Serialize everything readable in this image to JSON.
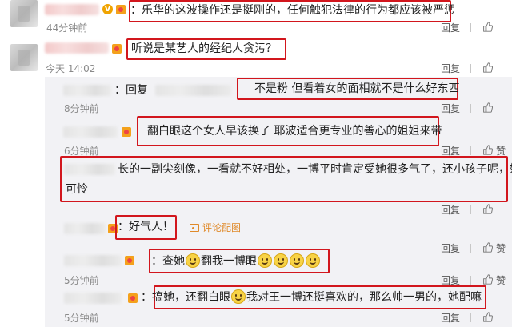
{
  "comments": [
    {
      "text": "：乐华的这波操作还是挺刚的，任何触犯法律的行为都应该被严惩",
      "time": "44分钟前",
      "reply": "回复"
    },
    {
      "text": "听说是某艺人的经纪人贪污？",
      "time": "今天 14:02",
      "reply": "回复"
    }
  ],
  "replies": [
    {
      "prefix": "：回复",
      "text": "不是粉 但看着女的面相就不是什么好东西",
      "time": "8分钟前",
      "reply": "回复"
    },
    {
      "text": "翻白眼这个女人早该换了 耶波适合更专业的善心的姐姐来带",
      "time": "6分钟前",
      "reply": "回复",
      "like": "赞"
    },
    {
      "line1": "长的一副尖刻像，一看就不好相处，一博平时肯定受她很多气了，还小孩子呢，好",
      "line2": "可怜",
      "reply": "回复"
    },
    {
      "text": "：好气人！",
      "image_link": "评论配图",
      "reply": "回复",
      "like": "赞"
    },
    {
      "text_a": "：查她",
      "text_b": "翻我一博眼",
      "time": "5分钟前",
      "reply": "回复",
      "like": "赞"
    },
    {
      "text_a": "：搞她，还翻白眼",
      "text_b": "我对王一博还挺喜欢的，那么帅一男的，她配嘛",
      "time": "5分钟前",
      "reply": "回复"
    }
  ],
  "icons": {
    "vip": "V",
    "like": "thumbs-up-icon",
    "image": "image-icon",
    "emoji": "smile-emoji-icon"
  }
}
